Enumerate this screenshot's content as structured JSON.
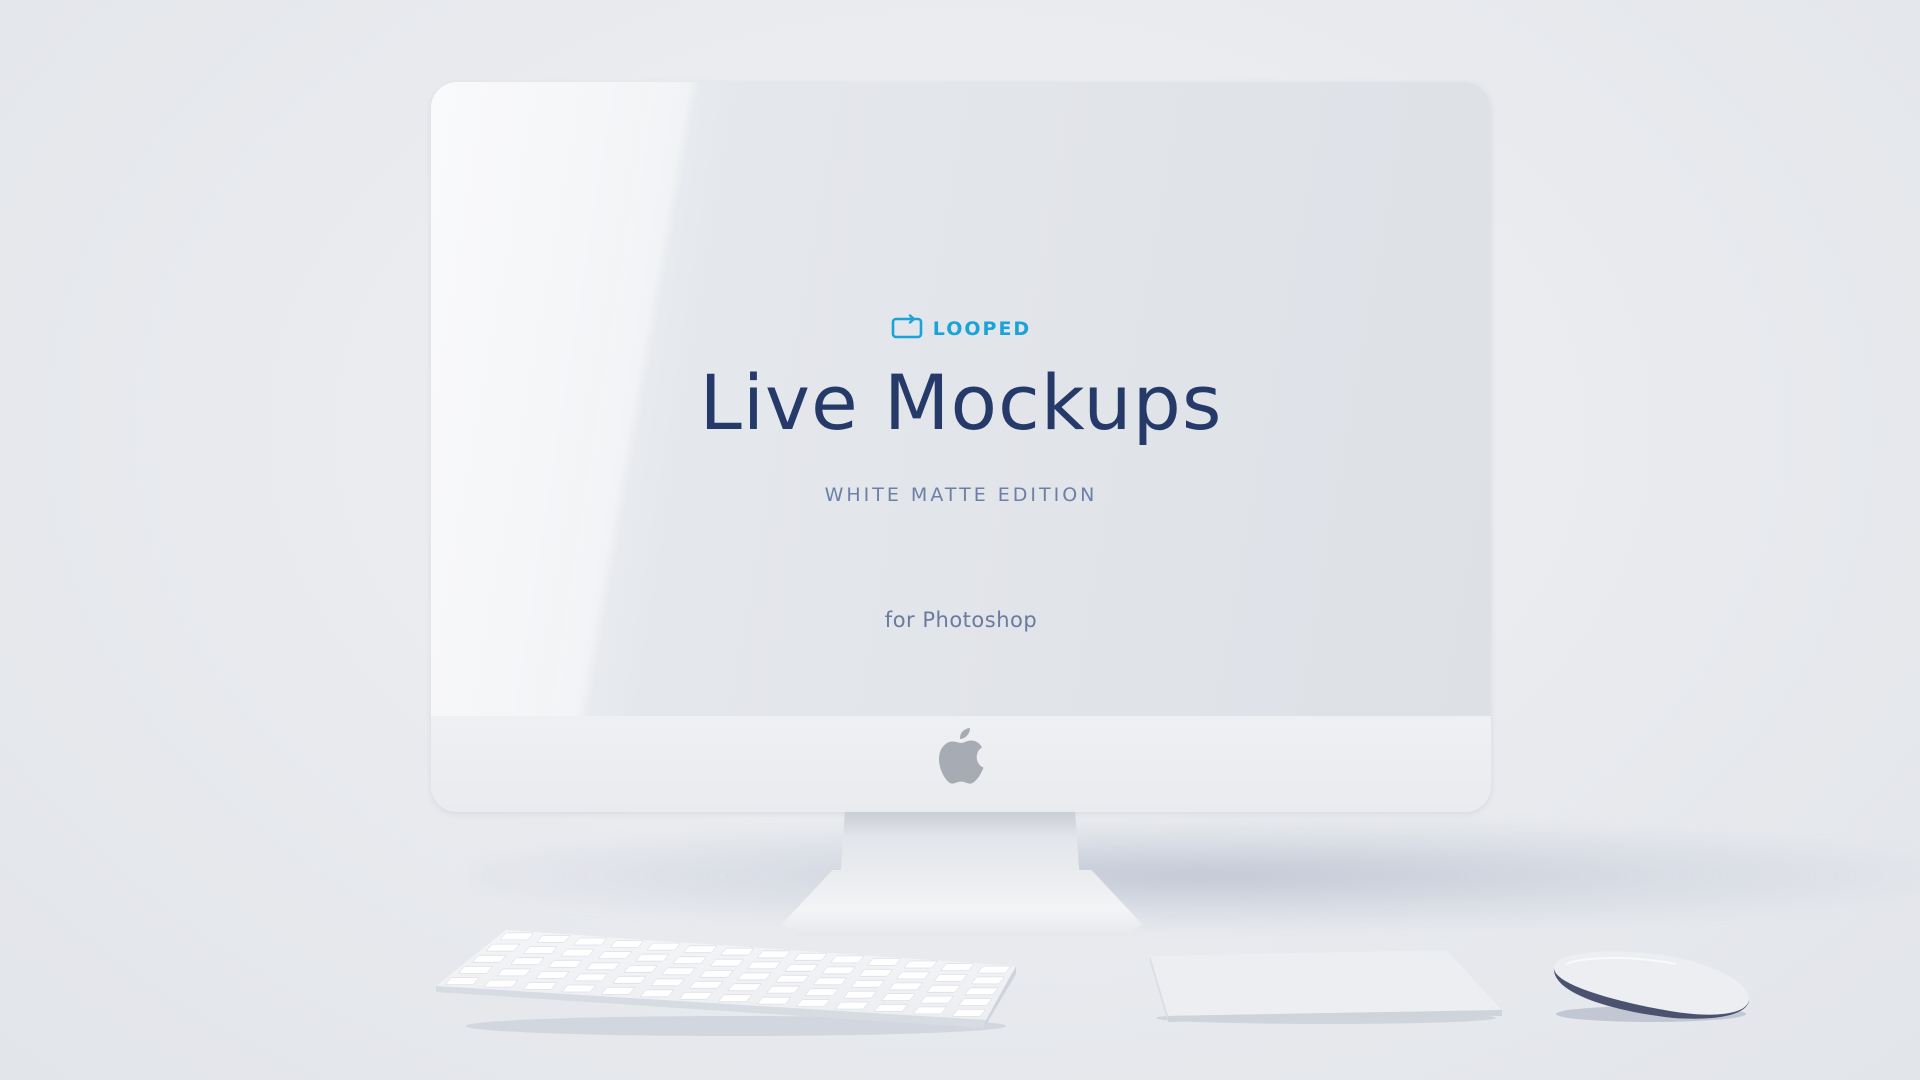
{
  "screen": {
    "badge_icon": "loop-icon",
    "badge_label": "LOOPED",
    "title": "Live Mockups",
    "subtitle": "WHITE MATTE EDITION",
    "platform": "for Photoshop"
  },
  "hardware": {
    "logo_icon": "apple-logo-icon",
    "keyboard_icon": "keyboard-icon",
    "trackpad_icon": "trackpad-icon",
    "mouse_icon": "mouse-icon"
  },
  "colors": {
    "accent": "#1aa3d9",
    "title": "#253a68",
    "subtitle": "#6d7fa7",
    "background": "#e9ebee"
  }
}
